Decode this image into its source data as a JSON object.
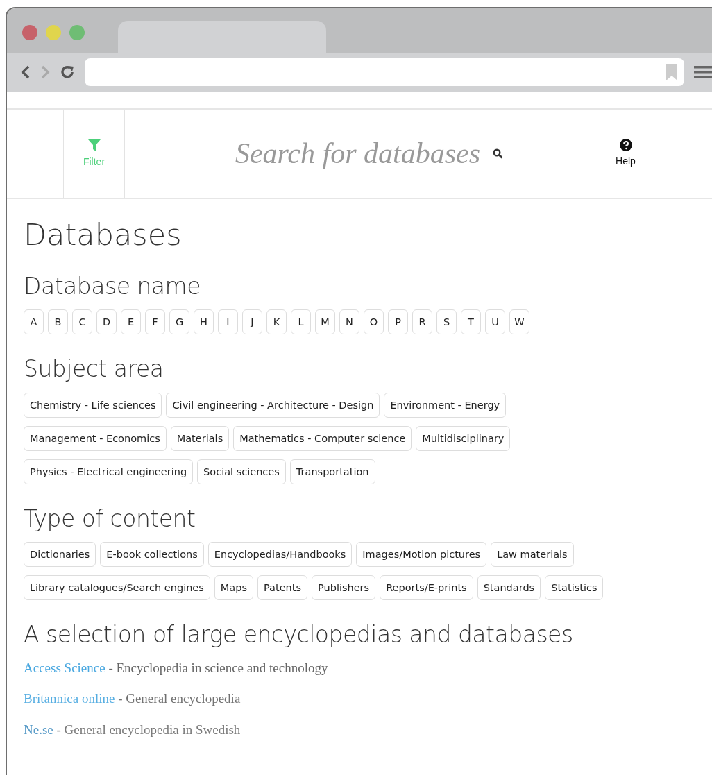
{
  "header": {
    "filter_label": "Filter",
    "search_placeholder": "Search for databases",
    "help_label": "Help"
  },
  "title": "Databases",
  "sections": [
    {
      "heading": "Database name",
      "kind": "letters",
      "tags": [
        "A",
        "B",
        "C",
        "D",
        "E",
        "F",
        "G",
        "H",
        "I",
        "J",
        "K",
        "L",
        "M",
        "N",
        "O",
        "P",
        "R",
        "S",
        "T",
        "U",
        "W"
      ]
    },
    {
      "heading": "Subject area",
      "kind": "tags",
      "tags": [
        "Chemistry - Life sciences",
        "Civil engineering - Architecture - Design",
        "Environment - Energy",
        "Management - Economics",
        "Materials",
        "Mathematics - Computer science",
        "Multidisciplinary",
        "Physics - Electrical engineering",
        "Social sciences",
        "Transportation"
      ]
    },
    {
      "heading": "Type of content",
      "kind": "tags",
      "tags": [
        "Dictionaries",
        "E-book collections",
        "Encyclopedias/Handbooks",
        "Images/Motion pictures",
        "Law materials",
        "Library catalogues/Search engines",
        "Maps",
        "Patents",
        "Publishers",
        "Reports/E-prints",
        "Standards",
        "Statistics"
      ]
    }
  ],
  "selection": {
    "heading": "A selection of large encyclopedias and databases",
    "items": [
      {
        "name": "Access Science",
        "description": "- Encyclopedia in science and technology"
      },
      {
        "name": "Britannica online",
        "description": "- General encyclopedia"
      },
      {
        "name": "Ne.se",
        "description": "- General encyclopedia in Swedish"
      }
    ]
  }
}
